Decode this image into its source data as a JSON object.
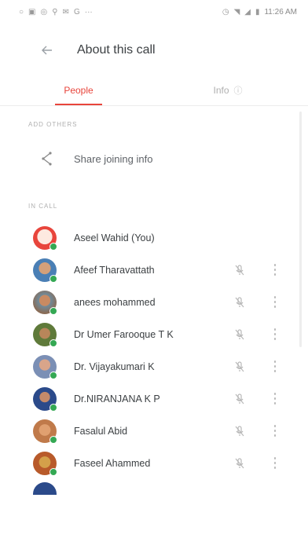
{
  "status_bar": {
    "left_icons": [
      "circle-icon",
      "app-icon",
      "whatsapp-icon",
      "person-icon",
      "email-icon",
      "google-icon",
      "more-dots-icon"
    ],
    "time": "11:26 AM"
  },
  "header": {
    "title": "About this call"
  },
  "tabs": [
    {
      "label": "People",
      "active": true
    },
    {
      "label": "Info",
      "active": false
    }
  ],
  "sections": {
    "add_others": "ADD OTHERS",
    "in_call": "IN CALL"
  },
  "share": {
    "label": "Share joining info"
  },
  "participants": [
    {
      "name": "Aseel Wahid (You)",
      "avatar_color": "#e8453c",
      "muted_icon": false,
      "more": false
    },
    {
      "name": "Afeef Tharavattath",
      "avatar_color": "#4a7fb5",
      "muted_icon": true,
      "more": true
    },
    {
      "name": "anees mohammed",
      "avatar_color": "#8a6b55",
      "muted_icon": true,
      "more": true
    },
    {
      "name": "Dr Umer Farooque T K",
      "avatar_color": "#5f7a3a",
      "muted_icon": true,
      "more": true
    },
    {
      "name": "Dr. Vijayakumari K",
      "avatar_color": "#7b8fb5",
      "muted_icon": true,
      "more": true
    },
    {
      "name": "Dr.NIRANJANA K P",
      "avatar_color": "#2b4a8a",
      "muted_icon": true,
      "more": true
    },
    {
      "name": "Fasalul Abid",
      "avatar_color": "#c07a4a",
      "muted_icon": true,
      "more": true
    },
    {
      "name": "Faseel Ahammed",
      "avatar_color": "#b85a2a",
      "muted_icon": true,
      "more": true
    }
  ],
  "colors": {
    "accent": "#e8453c",
    "online": "#34a853"
  }
}
